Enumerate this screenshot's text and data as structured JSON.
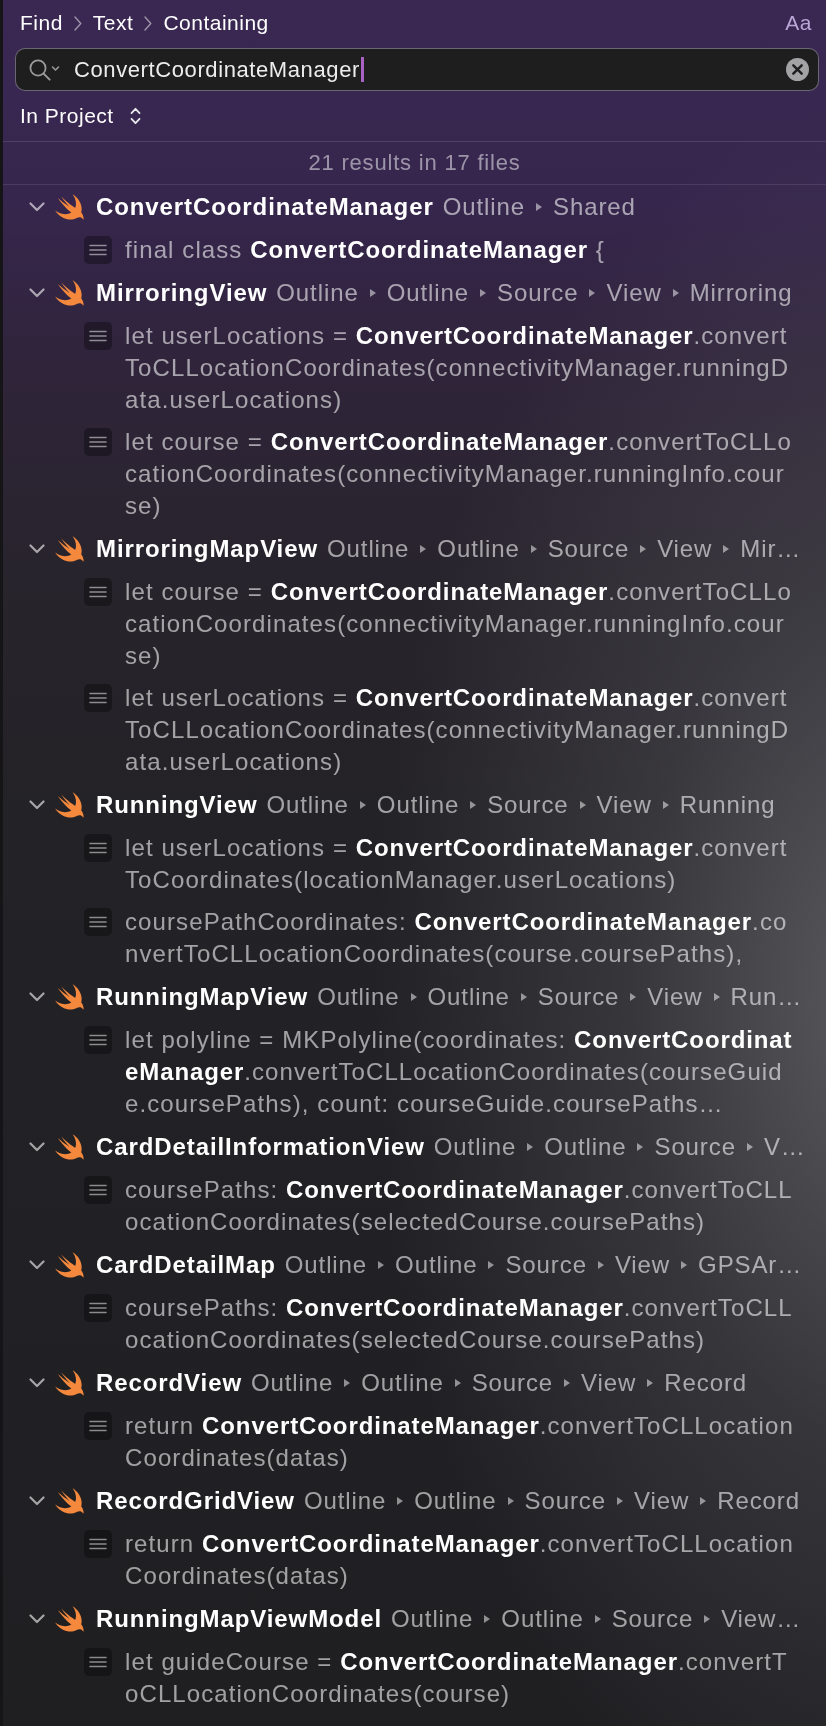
{
  "breadcrumb": [
    {
      "label": "Find"
    },
    {
      "label": "Text"
    },
    {
      "label": "Containing"
    }
  ],
  "match_case": {
    "label": "Aa"
  },
  "search": {
    "value": "ConvertCoordinateManager"
  },
  "scope": {
    "label": "In Project"
  },
  "summary": "21 results in 17 files",
  "results": [
    {
      "file": "ConvertCoordinateManager",
      "path": [
        "Outline",
        "Shared"
      ],
      "expanded": true,
      "matches": [
        "final class **ConvertCoordinateManager** {"
      ]
    },
    {
      "file": "MirroringView",
      "path": [
        "Outline",
        "Outline",
        "Source",
        "View",
        "Mirroring"
      ],
      "expanded": true,
      "matches": [
        "let userLocations = **ConvertCoordinateManager**.convertToCLLocationCoordinates(connectivityManager.runningData.userLocations)",
        "let course = **ConvertCoordinateManager**.convertToCLLocationCoordinates(connectivityManager.runningInfo.course)"
      ]
    },
    {
      "file": "MirroringMapView",
      "path": [
        "Outline",
        "Outline",
        "Source",
        "View",
        "Mir…"
      ],
      "expanded": true,
      "matches": [
        "let course = **ConvertCoordinateManager**.convertToCLLocationCoordinates(connectivityManager.runningInfo.course)",
        "let userLocations = **ConvertCoordinateManager**.convertToCLLocationCoordinates(connectivityManager.runningData.userLocations)"
      ]
    },
    {
      "file": "RunningView",
      "path": [
        "Outline",
        "Outline",
        "Source",
        "View",
        "Running"
      ],
      "expanded": true,
      "matches": [
        "let userLocations = **ConvertCoordinateManager**.convertToCoordinates(locationManager.userLocations)",
        "coursePathCoordinates: **ConvertCoordinateManager**.convertToCLLocationCoordinates(course.coursePaths),"
      ]
    },
    {
      "file": "RunningMapView",
      "path": [
        "Outline",
        "Outline",
        "Source",
        "View",
        "Run…"
      ],
      "expanded": true,
      "matches": [
        "let polyline = MKPolyline(coordinates: **ConvertCoordinateManager**.convertToCLLocationCoordinates(courseGuide.coursePaths), count: courseGuide.coursePaths…"
      ]
    },
    {
      "file": "CardDetailInformationView",
      "path": [
        "Outline",
        "Outline",
        "Source",
        "V…"
      ],
      "expanded": true,
      "matches": [
        "coursePaths: **ConvertCoordinateManager**.convertToCLLocationCoordinates(selectedCourse.coursePaths)"
      ]
    },
    {
      "file": "CardDetailMap",
      "path": [
        "Outline",
        "Outline",
        "Source",
        "View",
        "GPSAr…"
      ],
      "expanded": true,
      "matches": [
        "coursePaths: **ConvertCoordinateManager**.convertToCLLocationCoordinates(selectedCourse.coursePaths)"
      ]
    },
    {
      "file": "RecordView",
      "path": [
        "Outline",
        "Outline",
        "Source",
        "View",
        "Record"
      ],
      "expanded": true,
      "matches": [
        "return **ConvertCoordinateManager**.convertToCLLocationCoordinates(datas)"
      ]
    },
    {
      "file": "RecordGridView",
      "path": [
        "Outline",
        "Outline",
        "Source",
        "View",
        "Record"
      ],
      "expanded": true,
      "matches": [
        "return **ConvertCoordinateManager**.convertToCLLocationCoordinates(datas)"
      ]
    },
    {
      "file": "RunningMapViewModel",
      "path": [
        "Outline",
        "Outline",
        "Source",
        "View…"
      ],
      "expanded": true,
      "matches": [
        "let guideCourse = **ConvertCoordinateManager**.convertToCLLocationCoordinates(course)"
      ]
    }
  ]
}
